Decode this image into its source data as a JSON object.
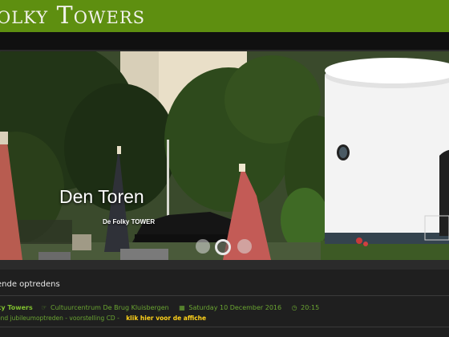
{
  "header": {
    "logo_text": "olky Towers",
    "brand_color": "#5e8f10"
  },
  "slider": {
    "title": "Den Toren",
    "subtitle": "De Folky TOWER",
    "dots": [
      {
        "state": "inactive"
      },
      {
        "state": "active"
      },
      {
        "state": "inactive"
      }
    ]
  },
  "events": {
    "heading": "ende optredens",
    "items": [
      {
        "band": "ky Towers",
        "venue_icon": "map-pointer-icon",
        "venue": "Cultuurcentrum De Brug Kluisbergen",
        "date_icon": "calendar-icon",
        "date": "Saturday 10 December 2016",
        "time_icon": "clock-icon",
        "time": "20:15",
        "description": "end jubileumoptreden - voorstelling CD -",
        "link": "klik hier voor de affiche"
      }
    ]
  }
}
